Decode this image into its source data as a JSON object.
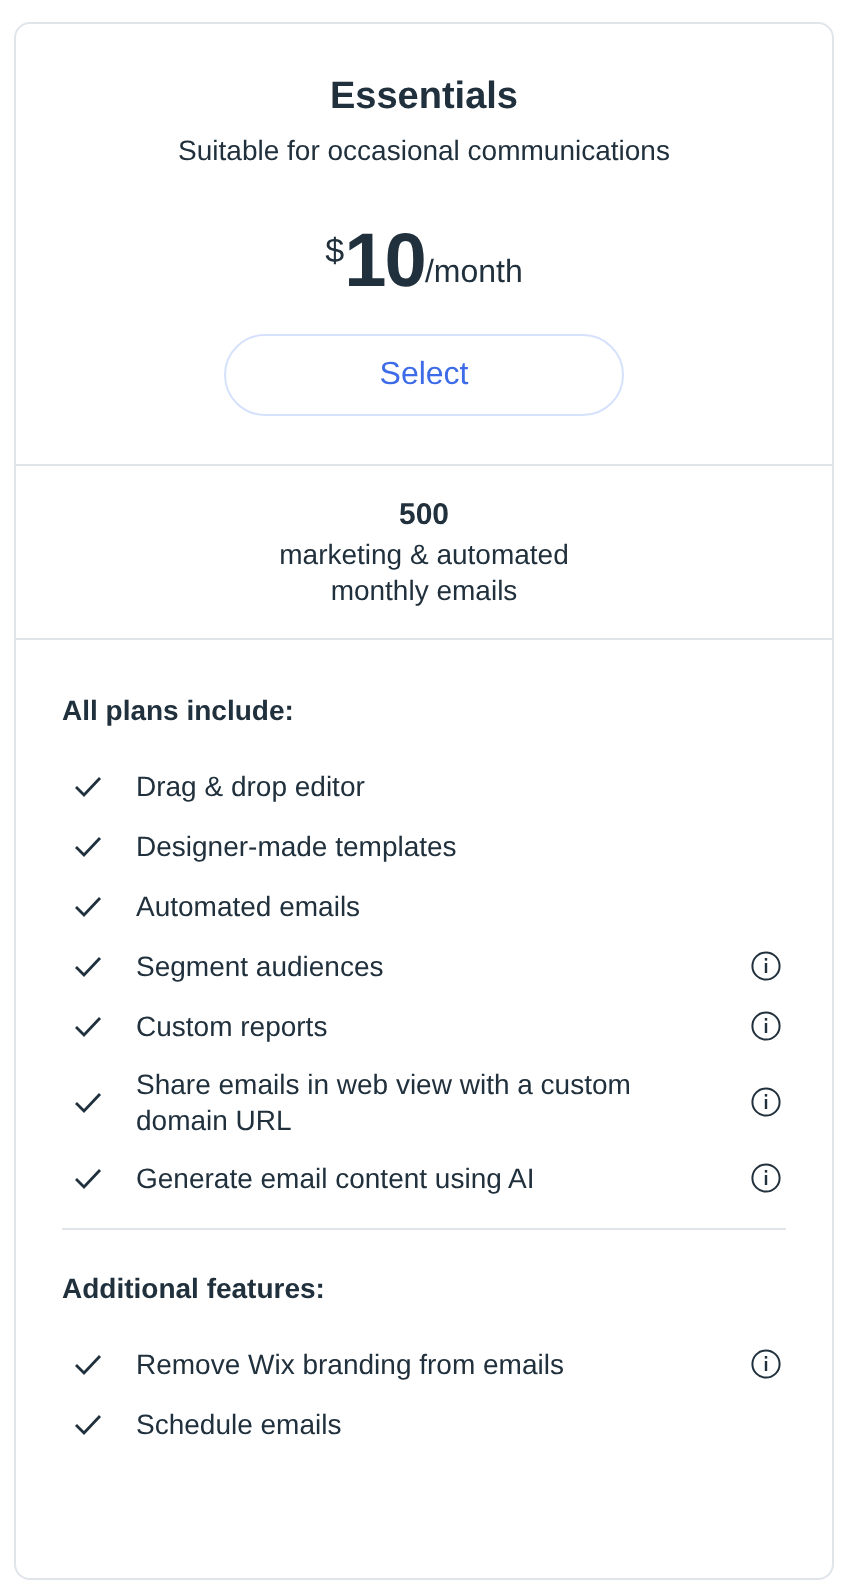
{
  "plan": {
    "title": "Essentials",
    "subtitle": "Suitable for occasional communications",
    "currency": "$",
    "price": "10",
    "period": "/month",
    "button": "Select"
  },
  "quota": {
    "amount": "500",
    "description": "marketing & automated monthly emails"
  },
  "sections": [
    {
      "heading": "All plans include:",
      "items": [
        {
          "label": "Drag & drop editor",
          "info": false
        },
        {
          "label": "Designer-made templates",
          "info": false
        },
        {
          "label": "Automated emails",
          "info": false
        },
        {
          "label": "Segment audiences",
          "info": true
        },
        {
          "label": "Custom reports",
          "info": true
        },
        {
          "label": "Share emails in web view with a custom domain URL",
          "info": true
        },
        {
          "label": "Generate email content using AI",
          "info": true
        }
      ]
    },
    {
      "heading": "Additional features:",
      "items": [
        {
          "label": "Remove Wix branding from emails",
          "info": true
        },
        {
          "label": "Schedule emails",
          "info": false
        }
      ]
    }
  ]
}
